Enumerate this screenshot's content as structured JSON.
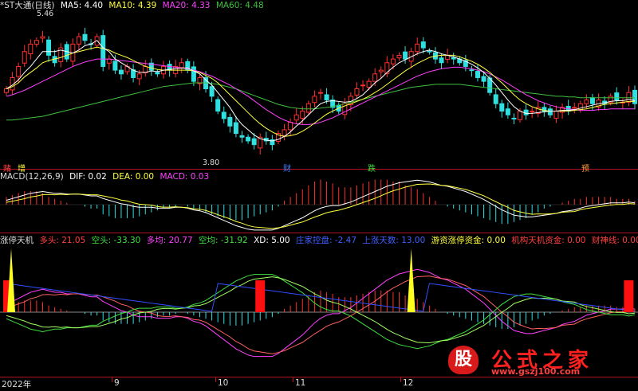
{
  "main_header": {
    "stock": "*ST大通(日线)",
    "ma5": "MA5: 4.40",
    "ma10": "MA10: 4.39",
    "ma20": "MA20: 4.33",
    "ma60": "MA60: 4.48"
  },
  "macd_header": {
    "name": "MACD(12,26,9)",
    "dif": "DIF: 0.02",
    "dea": "DEA: 0.00",
    "macd": "MACD: 0.03"
  },
  "tool_header": {
    "name": "涨停天机",
    "duotou": "多头: 21.05",
    "kongtou": "空头: -33.30",
    "duojun": "多均: 20.77",
    "kongjun": "空均: -31.92",
    "xd": "XD: 5.00",
    "zhuli": "庄家控盘: -2.47",
    "shangzhang": "上涨天数: 13.00",
    "youzi": "游资涨停资金: 0.00",
    "jigou": "机构天机资金: 0.00",
    "caishen": "财神线: 0.00"
  },
  "price_labels": {
    "high": "5.46",
    "low": "3.80"
  },
  "event_markers": [
    "赌",
    "增",
    "财",
    "跌",
    "预"
  ],
  "x_axis": [
    "2022年",
    "9",
    "10",
    "11",
    "12"
  ],
  "logo": {
    "badge": "股",
    "name": "公式之家",
    "url": "www.gszj100.com"
  },
  "colors": {
    "up": "#ff3030",
    "down": "#30e0e0",
    "ma5": "#ffffff",
    "ma10": "#ffff40",
    "ma20": "#ff40ff",
    "ma60": "#40c040",
    "separator": "#b01020"
  },
  "chart_data": {
    "type": "candlestick",
    "price_range": [
      3.6,
      5.6
    ],
    "closes": [
      4.6,
      4.75,
      4.9,
      5.1,
      5.2,
      5.25,
      5.3,
      5.05,
      4.95,
      5.15,
      5.0,
      5.2,
      5.3,
      5.25,
      5.2,
      5.3,
      4.9,
      5.0,
      4.85,
      4.8,
      4.9,
      4.75,
      4.8,
      4.9,
      4.85,
      4.8,
      4.9,
      4.85,
      4.9,
      4.95,
      4.85,
      4.7,
      4.75,
      4.6,
      4.5,
      4.3,
      4.2,
      4.1,
      4.0,
      3.95,
      3.9,
      3.85,
      3.95,
      3.9,
      3.85,
      4.0,
      4.05,
      4.15,
      4.25,
      4.3,
      4.4,
      4.5,
      4.55,
      4.45,
      4.35,
      4.3,
      4.4,
      4.5,
      4.6,
      4.65,
      4.7,
      4.8,
      4.85,
      4.95,
      5.0,
      5.05,
      5.0,
      5.1,
      5.2,
      5.15,
      5.1,
      5.0,
      4.95,
      5.05,
      5.0,
      4.95,
      4.9,
      4.85,
      4.75,
      4.7,
      4.55,
      4.4,
      4.3,
      4.25,
      4.2,
      4.3,
      4.25,
      4.3,
      4.35,
      4.3,
      4.25,
      4.3,
      4.35,
      4.3,
      4.35,
      4.4,
      4.45,
      4.4,
      4.45,
      4.4,
      4.5,
      4.45,
      4.42,
      4.55,
      4.4
    ],
    "ma5": [
      4.6,
      4.65,
      4.72,
      4.82,
      4.9,
      5.0,
      5.1,
      5.1,
      5.1,
      5.12,
      5.1,
      5.08,
      5.12,
      5.18,
      5.2,
      5.25,
      5.15,
      5.1,
      5.0,
      4.95,
      4.9,
      4.85,
      4.82,
      4.82,
      4.84,
      4.83,
      4.85,
      4.86,
      4.87,
      4.88,
      4.88,
      4.84,
      4.8,
      4.72,
      4.65,
      4.55,
      4.45,
      4.35,
      4.22,
      4.12,
      4.05,
      3.98,
      3.93,
      3.91,
      3.9,
      3.92,
      3.96,
      4.02,
      4.1,
      4.17,
      4.25,
      4.33,
      4.4,
      4.43,
      4.44,
      4.43,
      4.42,
      4.43,
      4.47,
      4.52,
      4.6,
      4.68,
      4.74,
      4.82,
      4.89,
      4.95,
      4.99,
      5.03,
      5.07,
      5.1,
      5.12,
      5.1,
      5.07,
      5.05,
      5.03,
      5.0,
      4.97,
      4.93,
      4.88,
      4.82,
      4.74,
      4.65,
      4.55,
      4.45,
      4.36,
      4.3,
      4.27,
      4.27,
      4.28,
      4.29,
      4.3,
      4.3,
      4.31,
      4.31,
      4.32,
      4.34,
      4.36,
      4.38,
      4.4,
      4.41,
      4.43,
      4.44,
      4.44,
      4.46,
      4.44
    ],
    "ma10": [
      4.6,
      4.63,
      4.68,
      4.76,
      4.82,
      4.88,
      4.95,
      4.98,
      5.0,
      5.02,
      5.05,
      5.08,
      5.1,
      5.12,
      5.14,
      5.16,
      5.14,
      5.12,
      5.08,
      5.05,
      5.02,
      4.98,
      4.94,
      4.9,
      4.88,
      4.86,
      4.85,
      4.85,
      4.85,
      4.85,
      4.85,
      4.84,
      4.82,
      4.78,
      4.74,
      4.68,
      4.6,
      4.52,
      4.44,
      4.36,
      4.28,
      4.2,
      4.13,
      4.07,
      4.02,
      3.98,
      3.96,
      3.97,
      3.99,
      4.03,
      4.08,
      4.14,
      4.2,
      4.26,
      4.3,
      4.34,
      4.37,
      4.4,
      4.43,
      4.46,
      4.5,
      4.55,
      4.6,
      4.66,
      4.72,
      4.78,
      4.84,
      4.89,
      4.94,
      4.98,
      5.02,
      5.04,
      5.05,
      5.05,
      5.05,
      5.03,
      5.0,
      4.97,
      4.93,
      4.88,
      4.82,
      4.75,
      4.68,
      4.6,
      4.52,
      4.45,
      4.4,
      4.36,
      4.33,
      4.31,
      4.3,
      4.3,
      4.3,
      4.3,
      4.31,
      4.32,
      4.33,
      4.35,
      4.37,
      4.39,
      4.4,
      4.41,
      4.42,
      4.43,
      4.43
    ],
    "ma20": [
      4.5,
      4.52,
      4.55,
      4.58,
      4.62,
      4.66,
      4.7,
      4.74,
      4.78,
      4.82,
      4.86,
      4.9,
      4.93,
      4.96,
      4.98,
      5.0,
      5.0,
      5.0,
      4.99,
      4.98,
      4.97,
      4.96,
      4.95,
      4.94,
      4.93,
      4.92,
      4.91,
      4.9,
      4.89,
      4.88,
      4.87,
      4.85,
      4.83,
      4.8,
      4.77,
      4.73,
      4.69,
      4.65,
      4.6,
      4.55,
      4.5,
      4.44,
      4.38,
      4.32,
      4.27,
      4.22,
      4.18,
      4.15,
      4.13,
      4.12,
      4.12,
      4.13,
      4.15,
      4.18,
      4.21,
      4.25,
      4.29,
      4.33,
      4.37,
      4.41,
      4.45,
      4.49,
      4.53,
      4.57,
      4.61,
      4.65,
      4.69,
      4.73,
      4.77,
      4.8,
      4.83,
      4.85,
      4.87,
      4.88,
      4.89,
      4.89,
      4.88,
      4.87,
      4.85,
      4.83,
      4.8,
      4.76,
      4.72,
      4.67,
      4.62,
      4.57,
      4.52,
      4.48,
      4.44,
      4.41,
      4.38,
      4.36,
      4.34,
      4.33,
      4.32,
      4.31,
      4.31,
      4.31,
      4.32,
      4.32,
      4.33,
      4.33,
      4.33,
      4.33,
      4.33
    ],
    "ma60": [
      4.18,
      4.18,
      4.19,
      4.2,
      4.21,
      4.22,
      4.23,
      4.25,
      4.27,
      4.29,
      4.31,
      4.33,
      4.35,
      4.37,
      4.39,
      4.41,
      4.43,
      4.45,
      4.47,
      4.49,
      4.51,
      4.53,
      4.55,
      4.57,
      4.59,
      4.61,
      4.63,
      4.64,
      4.65,
      4.66,
      4.67,
      4.68,
      4.68,
      4.68,
      4.67,
      4.66,
      4.64,
      4.62,
      4.6,
      4.57,
      4.54,
      4.51,
      4.48,
      4.45,
      4.42,
      4.39,
      4.37,
      4.35,
      4.34,
      4.33,
      4.33,
      4.33,
      4.34,
      4.35,
      4.36,
      4.38,
      4.4,
      4.42,
      4.44,
      4.46,
      4.48,
      4.5,
      4.52,
      4.54,
      4.56,
      4.58,
      4.6,
      4.62,
      4.63,
      4.64,
      4.65,
      4.66,
      4.66,
      4.66,
      4.66,
      4.66,
      4.65,
      4.64,
      4.63,
      4.62,
      4.61,
      4.6,
      4.59,
      4.58,
      4.57,
      4.56,
      4.55,
      4.54,
      4.53,
      4.52,
      4.51,
      4.5,
      4.5,
      4.49,
      4.49,
      4.48,
      4.48,
      4.48,
      4.48,
      4.48,
      4.48,
      4.48,
      4.48,
      4.48,
      4.48
    ],
    "macd_dif": [
      0.05,
      0.07,
      0.09,
      0.11,
      0.13,
      0.14,
      0.15,
      0.14,
      0.13,
      0.13,
      0.12,
      0.12,
      0.12,
      0.11,
      0.1,
      0.1,
      0.07,
      0.05,
      0.03,
      0.01,
      0.0,
      -0.02,
      -0.03,
      -0.03,
      -0.03,
      -0.04,
      -0.04,
      -0.04,
      -0.03,
      -0.03,
      -0.04,
      -0.06,
      -0.07,
      -0.09,
      -0.12,
      -0.15,
      -0.18,
      -0.21,
      -0.24,
      -0.26,
      -0.28,
      -0.29,
      -0.29,
      -0.29,
      -0.29,
      -0.27,
      -0.24,
      -0.21,
      -0.18,
      -0.15,
      -0.11,
      -0.07,
      -0.04,
      -0.02,
      -0.01,
      -0.01,
      0.01,
      0.03,
      0.06,
      0.09,
      0.12,
      0.15,
      0.18,
      0.21,
      0.23,
      0.25,
      0.26,
      0.27,
      0.28,
      0.27,
      0.26,
      0.24,
      0.22,
      0.21,
      0.19,
      0.17,
      0.15,
      0.12,
      0.09,
      0.06,
      0.02,
      -0.02,
      -0.06,
      -0.09,
      -0.12,
      -0.13,
      -0.14,
      -0.14,
      -0.13,
      -0.12,
      -0.11,
      -0.1,
      -0.08,
      -0.07,
      -0.06,
      -0.04,
      -0.02,
      -0.01,
      0.0,
      0.01,
      0.02,
      0.02,
      0.02,
      0.03,
      0.02
    ],
    "macd_hist": [
      0.04,
      0.05,
      0.06,
      0.07,
      0.07,
      0.07,
      0.06,
      0.04,
      0.03,
      0.02,
      0.01,
      0.0,
      0.0,
      -0.01,
      -0.02,
      -0.02,
      -0.05,
      -0.06,
      -0.07,
      -0.07,
      -0.07,
      -0.07,
      -0.06,
      -0.05,
      -0.04,
      -0.03,
      -0.02,
      -0.02,
      -0.01,
      0.0,
      -0.01,
      -0.02,
      -0.03,
      -0.04,
      -0.05,
      -0.06,
      -0.07,
      -0.08,
      -0.08,
      -0.08,
      -0.07,
      -0.06,
      -0.05,
      -0.04,
      -0.03,
      -0.01,
      0.02,
      0.04,
      0.06,
      0.08,
      0.1,
      0.12,
      0.13,
      0.12,
      0.11,
      0.09,
      0.09,
      0.09,
      0.1,
      0.11,
      0.12,
      0.13,
      0.13,
      0.13,
      0.12,
      0.12,
      0.1,
      0.09,
      0.08,
      0.06,
      0.04,
      0.02,
      0.0,
      -0.01,
      -0.02,
      -0.03,
      -0.04,
      -0.05,
      -0.06,
      -0.07,
      -0.08,
      -0.09,
      -0.1,
      -0.1,
      -0.09,
      -0.08,
      -0.07,
      -0.05,
      -0.04,
      -0.02,
      -0.01,
      0.0,
      0.01,
      0.02,
      0.03,
      0.03,
      0.04,
      0.04,
      0.04,
      0.04,
      0.04,
      0.03,
      0.03,
      0.03,
      0.02
    ],
    "tool_red_bars": [
      0,
      42,
      103
    ],
    "tool_spikes": [
      0,
      67,
      108
    ]
  }
}
